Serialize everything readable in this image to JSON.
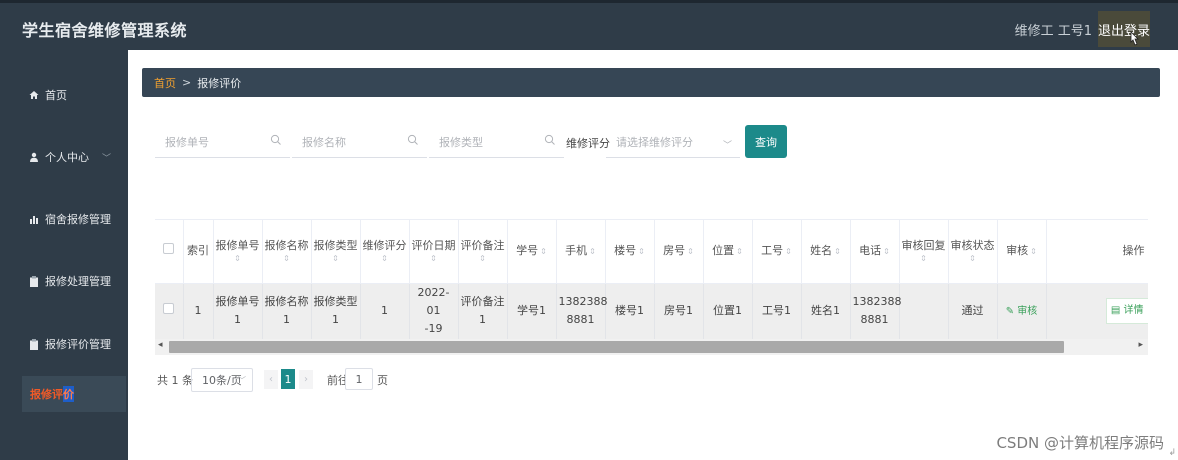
{
  "header": {
    "title": "学生宿舍维修管理系统",
    "user": "维修工 工号1",
    "logout": "退出登录"
  },
  "sidebar": {
    "items": [
      {
        "label": "首页",
        "icon": "home-icon"
      },
      {
        "label": "个人中心",
        "icon": "user-icon"
      },
      {
        "label": "宿舍报修管理",
        "icon": "bar-chart-icon"
      },
      {
        "label": "报修处理管理",
        "icon": "clipboard-icon"
      },
      {
        "label": "报修评价管理",
        "icon": "clipboard-icon"
      }
    ],
    "active_sub_a": "报修评",
    "active_sub_b": "价"
  },
  "breadcrumb": {
    "home": "首页",
    "sep": ">",
    "current": "报修评价"
  },
  "search": {
    "order_placeholder": "报修单号",
    "name_placeholder": "报修名称",
    "type_placeholder": "报修类型",
    "rating_label": "维修评分",
    "rating_placeholder": "请选择维修评分",
    "query_button": "查询"
  },
  "table": {
    "headers": {
      "index": "索引",
      "order_a": "报修单号",
      "name_a": "报修名称",
      "type_a": "报修类型",
      "rating_a": "维修评分",
      "date_a": "评价日期",
      "remark_a": "评价备注",
      "student_no": "学号",
      "phone": "手机",
      "building": "楼号",
      "room": "房号",
      "location": "位置",
      "worker_no": "工号",
      "worker_name": "姓名",
      "tel": "电话",
      "reply": "审核回复",
      "status": "审核状态",
      "audit": "审核",
      "actions": "操作"
    },
    "rows": [
      {
        "index": "1",
        "order_a": "报修单号",
        "order_b": "1",
        "name_a": "报修名称",
        "name_b": "1",
        "type_a": "报修类型",
        "type_b": "1",
        "rating": "1",
        "date_a": "2022-01",
        "date_b": "-19",
        "remark_a": "评价备注",
        "remark_b": "1",
        "student_no": "学号1",
        "phone_a": "1382388",
        "phone_b": "8881",
        "building": "楼号1",
        "room": "房号1",
        "location": "位置1",
        "worker_no": "工号1",
        "worker_name": "姓名1",
        "tel_a": "1382388",
        "tel_b": "8881",
        "reply": "",
        "status": "通过",
        "audit": "审核",
        "detail": "详情"
      }
    ]
  },
  "pagination": {
    "total": "共 1 条",
    "page_size": "10条/页",
    "current_page": "1",
    "goto_label": "前往",
    "goto_value": "1",
    "goto_suffix": "页"
  },
  "watermark": "CSDN @计算机程序源码",
  "colors": {
    "header_bg": "#2f3c48",
    "accent": "#1c8a8a",
    "breadcrumb_home": "#f0a030",
    "active_menu": "#f05a28"
  }
}
